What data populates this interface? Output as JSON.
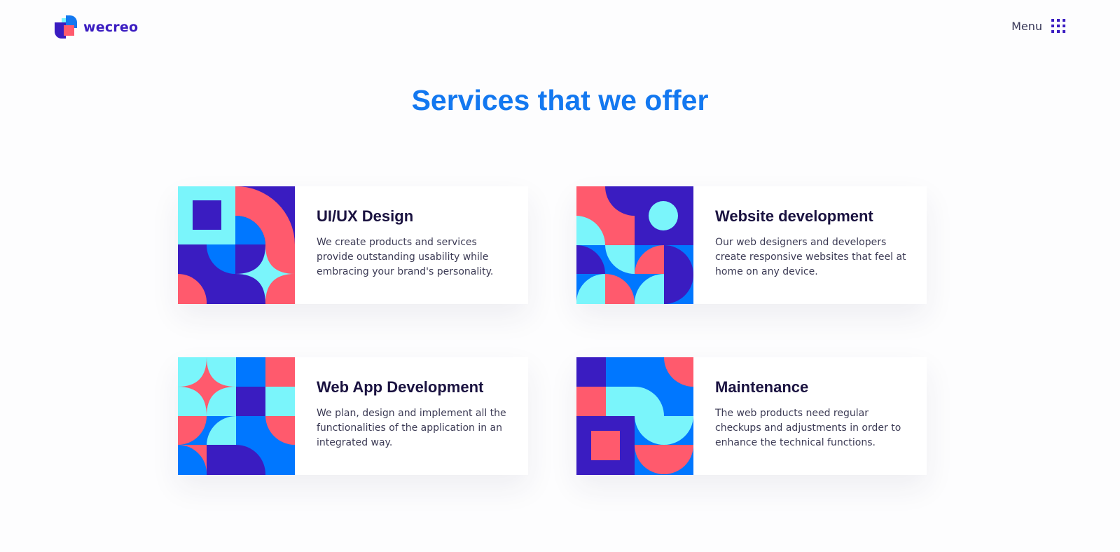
{
  "brand": {
    "name": "wecreo"
  },
  "nav": {
    "menu_label": "Menu"
  },
  "section": {
    "title": "Services that we offer"
  },
  "colors": {
    "navy": "#3a1cc1",
    "blue": "#0077ff",
    "cyan": "#7af5fb",
    "coral": "#ff5a6d",
    "heading_blue": "#1378f0"
  },
  "services": [
    {
      "title": "UI/UX Design",
      "description": "We create products and services provide outstanding usability while embracing your brand's personality."
    },
    {
      "title": "Website development",
      "description": "Our web designers and developers create responsive websites that feel at home on any device."
    },
    {
      "title": "Web App Development",
      "description": "We plan, design and implement all the functionalities of the application in an integrated way."
    },
    {
      "title": "Maintenance",
      "description": "The web products need regular checkups and adjustments in order to enhance the technical functions."
    }
  ]
}
